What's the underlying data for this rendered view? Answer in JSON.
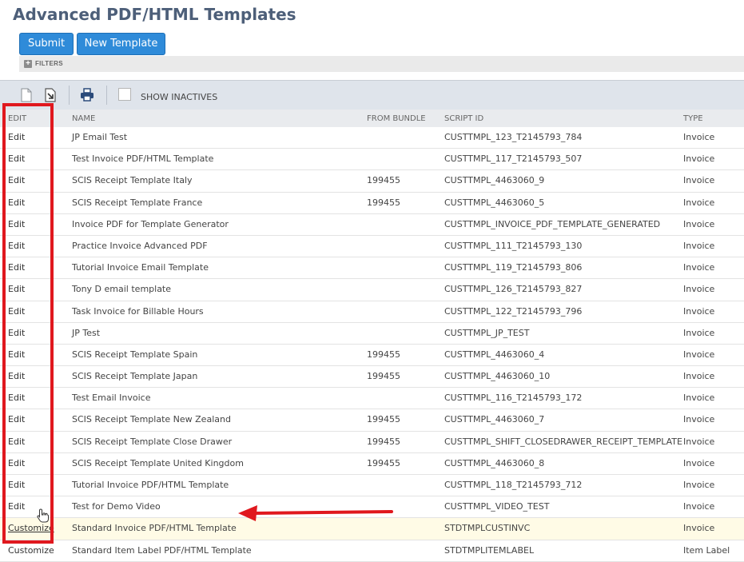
{
  "title": "Advanced PDF/HTML Templates",
  "buttons": {
    "submit": "Submit",
    "new_template": "New Template"
  },
  "filters": {
    "label": "FILTERS"
  },
  "toolbar": {
    "show_inactives": "SHOW INACTIVES",
    "show_inactives_checked": false
  },
  "columns": {
    "edit": "EDIT",
    "name": "NAME",
    "from_bundle": "FROM BUNDLE",
    "script_id": "SCRIPT ID",
    "type": "TYPE"
  },
  "rows": [
    {
      "action": "Edit",
      "name": "JP Email Test",
      "bundle": "",
      "script_id": "CUSTTMPL_123_T2145793_784",
      "type": "Invoice"
    },
    {
      "action": "Edit",
      "name": "Test Invoice PDF/HTML Template",
      "bundle": "",
      "script_id": "CUSTTMPL_117_T2145793_507",
      "type": "Invoice"
    },
    {
      "action": "Edit",
      "name": "SCIS Receipt Template Italy",
      "bundle": "199455",
      "script_id": "CUSTTMPL_4463060_9",
      "type": "Invoice"
    },
    {
      "action": "Edit",
      "name": "SCIS Receipt Template France",
      "bundle": "199455",
      "script_id": "CUSTTMPL_4463060_5",
      "type": "Invoice"
    },
    {
      "action": "Edit",
      "name": "Invoice PDF for Template Generator",
      "bundle": "",
      "script_id": "CUSTTMPL_INVOICE_PDF_TEMPLATE_GENERATED",
      "type": "Invoice"
    },
    {
      "action": "Edit",
      "name": "Practice Invoice Advanced PDF",
      "bundle": "",
      "script_id": "CUSTTMPL_111_T2145793_130",
      "type": "Invoice"
    },
    {
      "action": "Edit",
      "name": "Tutorial Invoice Email Template",
      "bundle": "",
      "script_id": "CUSTTMPL_119_T2145793_806",
      "type": "Invoice"
    },
    {
      "action": "Edit",
      "name": "Tony D email template",
      "bundle": "",
      "script_id": "CUSTTMPL_126_T2145793_827",
      "type": "Invoice"
    },
    {
      "action": "Edit",
      "name": "Task Invoice for Billable Hours",
      "bundle": "",
      "script_id": "CUSTTMPL_122_T2145793_796",
      "type": "Invoice"
    },
    {
      "action": "Edit",
      "name": "JP Test",
      "bundle": "",
      "script_id": "CUSTTMPL_JP_TEST",
      "type": "Invoice"
    },
    {
      "action": "Edit",
      "name": "SCIS Receipt Template Spain",
      "bundle": "199455",
      "script_id": "CUSTTMPL_4463060_4",
      "type": "Invoice"
    },
    {
      "action": "Edit",
      "name": "SCIS Receipt Template Japan",
      "bundle": "199455",
      "script_id": "CUSTTMPL_4463060_10",
      "type": "Invoice"
    },
    {
      "action": "Edit",
      "name": "Test Email Invoice",
      "bundle": "",
      "script_id": "CUSTTMPL_116_T2145793_172",
      "type": "Invoice"
    },
    {
      "action": "Edit",
      "name": "SCIS Receipt Template New Zealand",
      "bundle": "199455",
      "script_id": "CUSTTMPL_4463060_7",
      "type": "Invoice"
    },
    {
      "action": "Edit",
      "name": "SCIS Receipt Template Close Drawer",
      "bundle": "199455",
      "script_id": "CUSTTMPL_SHIFT_CLOSEDRAWER_RECEIPT_TEMPLATE",
      "type": "Invoice"
    },
    {
      "action": "Edit",
      "name": "SCIS Receipt Template United Kingdom",
      "bundle": "199455",
      "script_id": "CUSTTMPL_4463060_8",
      "type": "Invoice"
    },
    {
      "action": "Edit",
      "name": "Tutorial Invoice PDF/HTML Template",
      "bundle": "",
      "script_id": "CUSTTMPL_118_T2145793_712",
      "type": "Invoice"
    },
    {
      "action": "Edit",
      "name": "Test for Demo Video",
      "bundle": "",
      "script_id": "CUSTTMPL_VIDEO_TEST",
      "type": "Invoice"
    },
    {
      "action": "Customize",
      "name": "Standard Invoice PDF/HTML Template",
      "bundle": "",
      "script_id": "STDTMPLCUSTINVC",
      "type": "Invoice"
    },
    {
      "action": "Customize",
      "name": "Standard Item Label PDF/HTML Template",
      "bundle": "",
      "script_id": "STDTMPLITEMLABEL",
      "type": "Item Label"
    }
  ],
  "colors": {
    "button": "#2f8bd9",
    "title": "#4d5f79",
    "highlight": "#e0181e"
  }
}
